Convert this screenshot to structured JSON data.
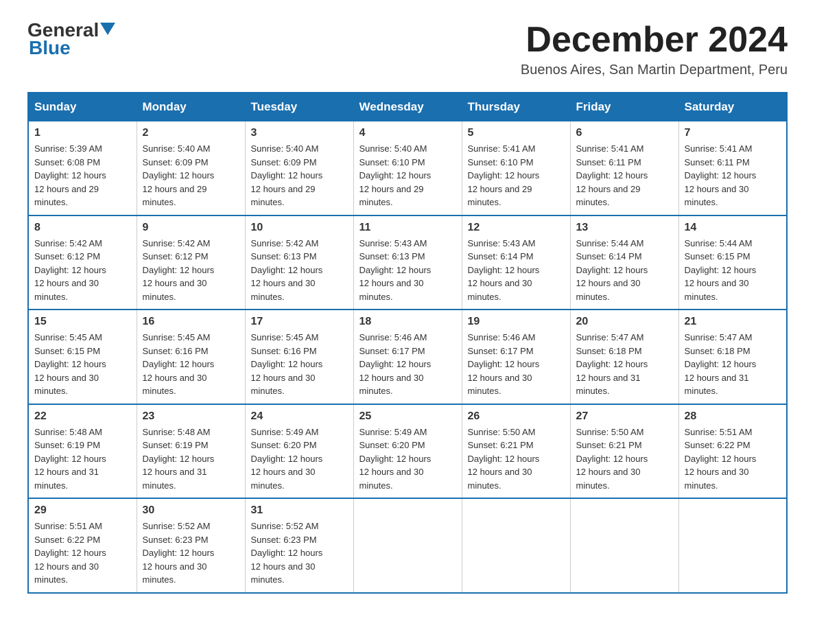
{
  "logo": {
    "line1": "General",
    "arrow": true,
    "line2": "Blue"
  },
  "title": "December 2024",
  "subtitle": "Buenos Aires, San Martin Department, Peru",
  "weekdays": [
    "Sunday",
    "Monday",
    "Tuesday",
    "Wednesday",
    "Thursday",
    "Friday",
    "Saturday"
  ],
  "weeks": [
    [
      {
        "day": "1",
        "sunrise": "5:39 AM",
        "sunset": "6:08 PM",
        "daylight": "12 hours and 29 minutes."
      },
      {
        "day": "2",
        "sunrise": "5:40 AM",
        "sunset": "6:09 PM",
        "daylight": "12 hours and 29 minutes."
      },
      {
        "day": "3",
        "sunrise": "5:40 AM",
        "sunset": "6:09 PM",
        "daylight": "12 hours and 29 minutes."
      },
      {
        "day": "4",
        "sunrise": "5:40 AM",
        "sunset": "6:10 PM",
        "daylight": "12 hours and 29 minutes."
      },
      {
        "day": "5",
        "sunrise": "5:41 AM",
        "sunset": "6:10 PM",
        "daylight": "12 hours and 29 minutes."
      },
      {
        "day": "6",
        "sunrise": "5:41 AM",
        "sunset": "6:11 PM",
        "daylight": "12 hours and 29 minutes."
      },
      {
        "day": "7",
        "sunrise": "5:41 AM",
        "sunset": "6:11 PM",
        "daylight": "12 hours and 30 minutes."
      }
    ],
    [
      {
        "day": "8",
        "sunrise": "5:42 AM",
        "sunset": "6:12 PM",
        "daylight": "12 hours and 30 minutes."
      },
      {
        "day": "9",
        "sunrise": "5:42 AM",
        "sunset": "6:12 PM",
        "daylight": "12 hours and 30 minutes."
      },
      {
        "day": "10",
        "sunrise": "5:42 AM",
        "sunset": "6:13 PM",
        "daylight": "12 hours and 30 minutes."
      },
      {
        "day": "11",
        "sunrise": "5:43 AM",
        "sunset": "6:13 PM",
        "daylight": "12 hours and 30 minutes."
      },
      {
        "day": "12",
        "sunrise": "5:43 AM",
        "sunset": "6:14 PM",
        "daylight": "12 hours and 30 minutes."
      },
      {
        "day": "13",
        "sunrise": "5:44 AM",
        "sunset": "6:14 PM",
        "daylight": "12 hours and 30 minutes."
      },
      {
        "day": "14",
        "sunrise": "5:44 AM",
        "sunset": "6:15 PM",
        "daylight": "12 hours and 30 minutes."
      }
    ],
    [
      {
        "day": "15",
        "sunrise": "5:45 AM",
        "sunset": "6:15 PM",
        "daylight": "12 hours and 30 minutes."
      },
      {
        "day": "16",
        "sunrise": "5:45 AM",
        "sunset": "6:16 PM",
        "daylight": "12 hours and 30 minutes."
      },
      {
        "day": "17",
        "sunrise": "5:45 AM",
        "sunset": "6:16 PM",
        "daylight": "12 hours and 30 minutes."
      },
      {
        "day": "18",
        "sunrise": "5:46 AM",
        "sunset": "6:17 PM",
        "daylight": "12 hours and 30 minutes."
      },
      {
        "day": "19",
        "sunrise": "5:46 AM",
        "sunset": "6:17 PM",
        "daylight": "12 hours and 30 minutes."
      },
      {
        "day": "20",
        "sunrise": "5:47 AM",
        "sunset": "6:18 PM",
        "daylight": "12 hours and 31 minutes."
      },
      {
        "day": "21",
        "sunrise": "5:47 AM",
        "sunset": "6:18 PM",
        "daylight": "12 hours and 31 minutes."
      }
    ],
    [
      {
        "day": "22",
        "sunrise": "5:48 AM",
        "sunset": "6:19 PM",
        "daylight": "12 hours and 31 minutes."
      },
      {
        "day": "23",
        "sunrise": "5:48 AM",
        "sunset": "6:19 PM",
        "daylight": "12 hours and 31 minutes."
      },
      {
        "day": "24",
        "sunrise": "5:49 AM",
        "sunset": "6:20 PM",
        "daylight": "12 hours and 30 minutes."
      },
      {
        "day": "25",
        "sunrise": "5:49 AM",
        "sunset": "6:20 PM",
        "daylight": "12 hours and 30 minutes."
      },
      {
        "day": "26",
        "sunrise": "5:50 AM",
        "sunset": "6:21 PM",
        "daylight": "12 hours and 30 minutes."
      },
      {
        "day": "27",
        "sunrise": "5:50 AM",
        "sunset": "6:21 PM",
        "daylight": "12 hours and 30 minutes."
      },
      {
        "day": "28",
        "sunrise": "5:51 AM",
        "sunset": "6:22 PM",
        "daylight": "12 hours and 30 minutes."
      }
    ],
    [
      {
        "day": "29",
        "sunrise": "5:51 AM",
        "sunset": "6:22 PM",
        "daylight": "12 hours and 30 minutes."
      },
      {
        "day": "30",
        "sunrise": "5:52 AM",
        "sunset": "6:23 PM",
        "daylight": "12 hours and 30 minutes."
      },
      {
        "day": "31",
        "sunrise": "5:52 AM",
        "sunset": "6:23 PM",
        "daylight": "12 hours and 30 minutes."
      },
      null,
      null,
      null,
      null
    ]
  ]
}
